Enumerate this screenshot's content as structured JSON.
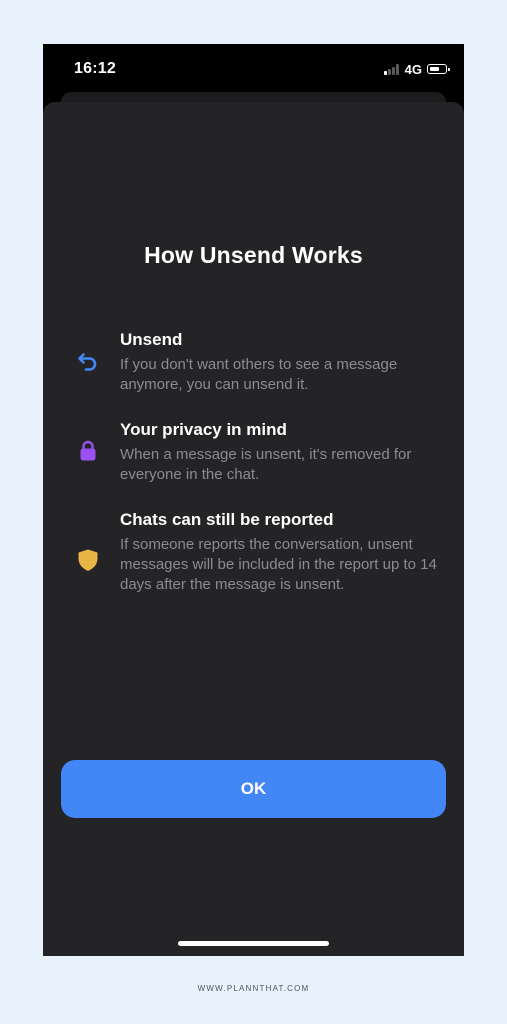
{
  "status_bar": {
    "time": "16:12",
    "network": "4G",
    "signal_bars_active": 1,
    "signal_bars_total": 4,
    "battery_level": 0.55
  },
  "sheet": {
    "title": "How Unsend Works",
    "features": [
      {
        "icon": "undo-arrow-icon",
        "icon_color": "#4287f5",
        "title": "Unsend",
        "description": "If you don't want others to see a message anymore, you can unsend it."
      },
      {
        "icon": "lock-icon",
        "icon_color": "#9b51f0",
        "title": "Your privacy in mind",
        "description": "When a message is unsent, it's removed for everyone in the chat."
      },
      {
        "icon": "shield-icon",
        "icon_color": "#e8b443",
        "title": "Chats can still be reported",
        "description": "If someone reports the conversation, unsent messages will be included in the report up to 14 days after the message is unsent."
      }
    ],
    "ok_label": "OK"
  },
  "colors": {
    "page_background": "#e8f2fc",
    "sheet_background": "#242426",
    "accent": "#4287f5",
    "secondary_text": "#8c8c90"
  },
  "footer": {
    "text": "WWW.PLANNTHAT.COM"
  }
}
